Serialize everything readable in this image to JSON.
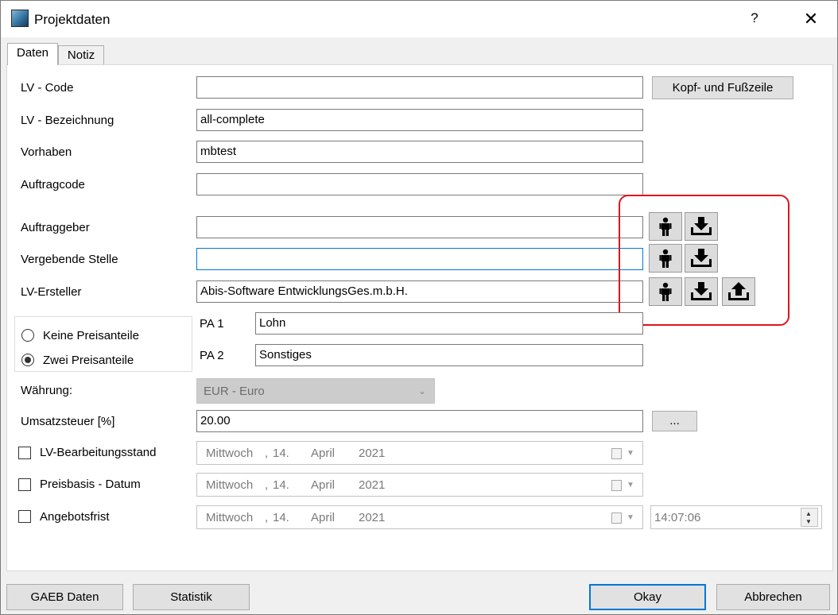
{
  "window": {
    "title": "Projektdaten",
    "help_label": "?",
    "close_label": "✕"
  },
  "tabs": [
    {
      "label": "Daten",
      "active": true
    },
    {
      "label": "Notiz",
      "active": false
    }
  ],
  "fields": {
    "lv_code": {
      "label": "LV - Code",
      "value": ""
    },
    "lv_bezeichnung": {
      "label": "LV - Bezeichnung",
      "value": "all-complete"
    },
    "vorhaben": {
      "label": "Vorhaben",
      "value": "mbtest"
    },
    "auftragcode": {
      "label": "Auftragcode",
      "value": ""
    },
    "auftraggeber": {
      "label": "Auftraggeber",
      "value": ""
    },
    "vergebende_stelle": {
      "label": "Vergebende Stelle",
      "value": ""
    },
    "lv_ersteller": {
      "label": "LV-Ersteller",
      "value": "Abis-Software EntwicklungsGes.m.b.H."
    }
  },
  "buttons": {
    "kopf_fusszeile": "Kopf- und Fußzeile",
    "umsatzsteuer_more": "...",
    "gaeb_daten": "GAEB Daten",
    "statistik": "Statistik",
    "okay": "Okay",
    "abbrechen": "Abbrechen"
  },
  "icons": {
    "person": "person-icon",
    "download": "download-icon",
    "upload": "upload-icon"
  },
  "preisanteile": {
    "options": [
      {
        "label": "Keine Preisanteile",
        "checked": false
      },
      {
        "label": "Zwei Preisanteile",
        "checked": true
      }
    ],
    "pa1": {
      "label": "PA 1",
      "value": "Lohn"
    },
    "pa2": {
      "label": "PA 2",
      "value": "Sonstiges"
    }
  },
  "waehrung": {
    "label": "Währung:",
    "value": "EUR - Euro"
  },
  "umsatzsteuer": {
    "label": "Umsatzsteuer [%]",
    "value": "20.00"
  },
  "dates": [
    {
      "label": "LV-Bearbeitungsstand",
      "checked": false,
      "weekday": "Mittwoch",
      "sep": ",",
      "day": "14.",
      "month": "April",
      "year": "2021"
    },
    {
      "label": "Preisbasis - Datum",
      "checked": false,
      "weekday": "Mittwoch",
      "sep": ",",
      "day": "14.",
      "month": "April",
      "year": "2021"
    },
    {
      "label": "Angebotsfrist",
      "checked": false,
      "weekday": "Mittwoch",
      "sep": ",",
      "day": "14.",
      "month": "April",
      "year": "2021"
    }
  ],
  "angebotsfrist_time": "14:07:06",
  "colors": {
    "highlight": "#e0141b",
    "focus_border": "#0078d7"
  }
}
